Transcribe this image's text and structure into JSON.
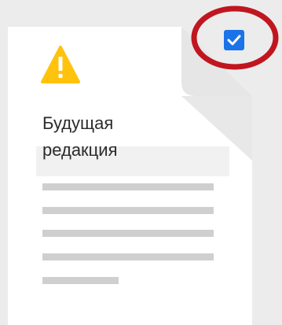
{
  "document": {
    "status_icon": "warning-icon",
    "title_line1": "Будущая",
    "title_line2": "редакция",
    "text_placeholder_lines": 5
  },
  "checkbox": {
    "checked": true,
    "icon": "checkmark-icon"
  },
  "annotation": {
    "shape": "ellipse",
    "color": "#c0161f"
  },
  "colors": {
    "background": "#ececec",
    "card": "#ffffff",
    "warning": "#ffc20e",
    "checkbox": "#1a73e8",
    "placeholder": "#cfcfcf",
    "highlight_ring": "#c0161f"
  }
}
